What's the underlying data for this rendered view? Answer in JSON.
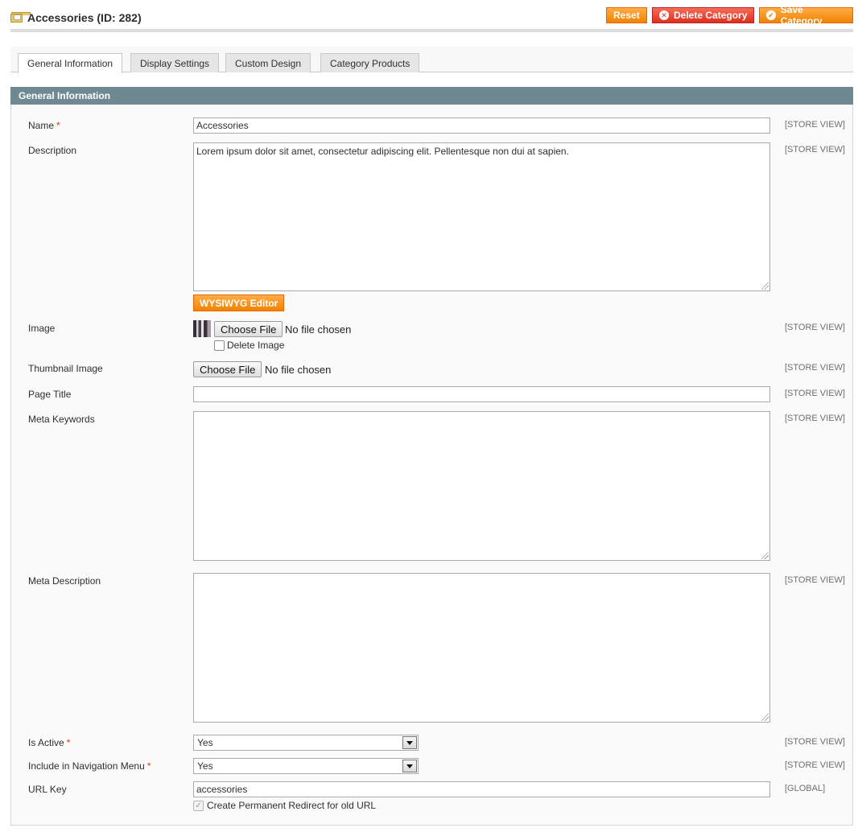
{
  "header": {
    "title": "Accessories (ID: 282)",
    "buttons": {
      "reset": "Reset",
      "delete": "Delete Category",
      "save": "Save Category"
    }
  },
  "tabs": [
    {
      "label": "General Information",
      "active": true
    },
    {
      "label": "Display Settings"
    },
    {
      "label": "Custom Design"
    },
    {
      "label": "Category Products"
    }
  ],
  "section": {
    "title": "General Information"
  },
  "fields": {
    "name": {
      "label": "Name",
      "required": "*",
      "value": "Accessories",
      "scope": "[STORE VIEW]"
    },
    "description": {
      "label": "Description",
      "value": "Lorem ipsum dolor sit amet, consectetur adipiscing elit. Pellentesque non dui at sapien.",
      "scope": "[STORE VIEW]",
      "wysiwyg_label": "WYSIWYG Editor"
    },
    "image": {
      "label": "Image",
      "button": "Choose File",
      "file_text": "No file chosen",
      "delete_label": "Delete Image",
      "scope": "[STORE VIEW]"
    },
    "thumbnail": {
      "label": "Thumbnail Image",
      "button": "Choose File",
      "file_text": "No file chosen",
      "scope": "[STORE VIEW]"
    },
    "page_title": {
      "label": "Page Title",
      "value": "",
      "scope": "[STORE VIEW]"
    },
    "meta_keywords": {
      "label": "Meta Keywords",
      "value": "",
      "scope": "[STORE VIEW]"
    },
    "meta_description": {
      "label": "Meta Description",
      "value": "",
      "scope": "[STORE VIEW]"
    },
    "is_active": {
      "label": "Is Active",
      "required": "*",
      "value": "Yes",
      "scope": "[STORE VIEW]"
    },
    "include_nav": {
      "label": "Include in Navigation Menu",
      "required": "*",
      "value": "Yes",
      "scope": "[STORE VIEW]"
    },
    "url_key": {
      "label": "URL Key",
      "value": "accessories",
      "scope": "[GLOBAL]",
      "redirect_label": "Create Permanent Redirect for old URL"
    }
  },
  "colors": {
    "accent": "#f18200",
    "section_header": "#6f8992",
    "danger": "#e02f1f"
  }
}
